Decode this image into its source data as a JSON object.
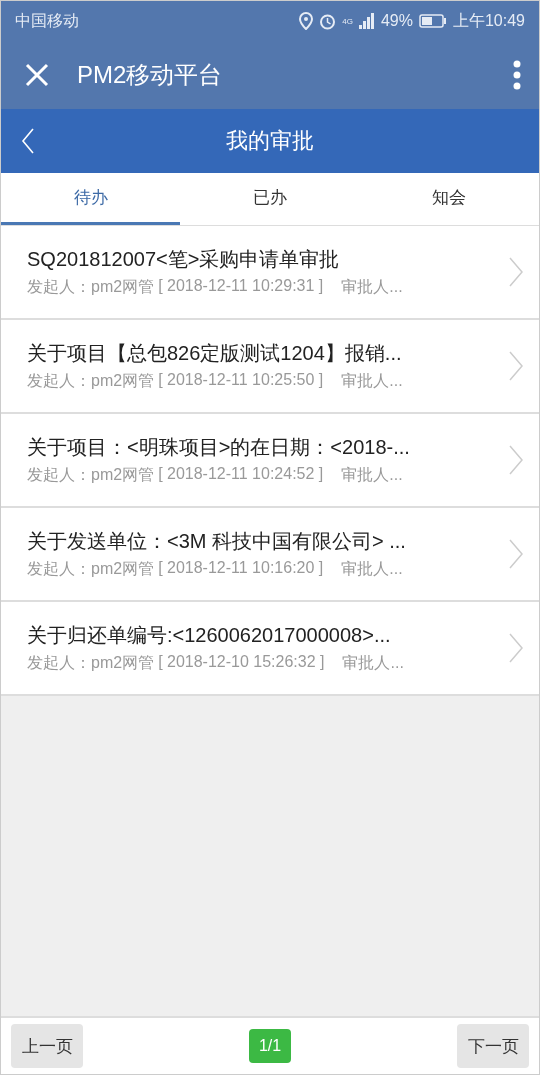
{
  "status_bar": {
    "carrier": "中国移动",
    "network": "4G",
    "battery": "49%",
    "time": "上午10:49"
  },
  "app_bar": {
    "title": "PM2移动平台"
  },
  "header": {
    "title": "我的审批"
  },
  "tabs": [
    {
      "label": "待办",
      "selected": true
    },
    {
      "label": "已办",
      "selected": false
    },
    {
      "label": "知会",
      "selected": false
    }
  ],
  "items": [
    {
      "title": "SQ201812007<笔>采购申请单审批",
      "initiator": "发起人：pm2网管",
      "time": "[ 2018-12-11 10:29:31 ]",
      "approver": "审批人..."
    },
    {
      "title": "关于项目【总包826定版测试1204】报销...",
      "initiator": "发起人：pm2网管",
      "time": "[ 2018-12-11 10:25:50 ]",
      "approver": "审批人..."
    },
    {
      "title": "关于项目：<明珠项目>的在日期：<2018-...",
      "initiator": "发起人：pm2网管",
      "time": "[ 2018-12-11 10:24:52 ]",
      "approver": "审批人..."
    },
    {
      "title": "关于发送单位：<3M 科技中国有限公司> ...",
      "initiator": "发起人：pm2网管",
      "time": "[ 2018-12-11 10:16:20 ]",
      "approver": "审批人..."
    },
    {
      "title": "关于归还单编号:<1260062017000008>...",
      "initiator": "发起人：pm2网管",
      "time": "[ 2018-12-10 15:26:32 ]",
      "approver": "审批人..."
    }
  ],
  "pager": {
    "prev": "上一页",
    "page": "1/1",
    "next": "下一页"
  }
}
